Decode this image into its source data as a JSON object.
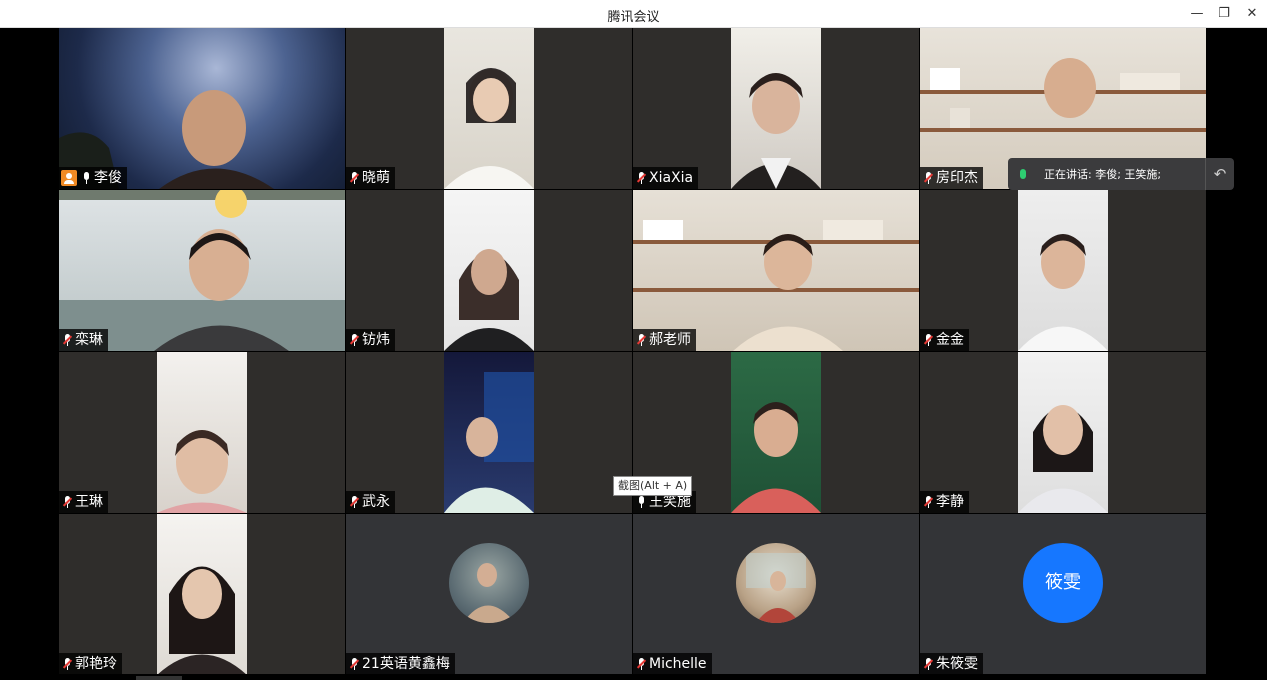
{
  "window": {
    "title": "腾讯会议",
    "minimize": "—",
    "restore": "❐",
    "close": "✕"
  },
  "participants": [
    {
      "name": "李俊",
      "host": true,
      "mic": "on"
    },
    {
      "name": "晓萌",
      "mic": "muted"
    },
    {
      "name": "XiaXia",
      "mic": "muted"
    },
    {
      "name": "房印杰",
      "mic": "muted"
    },
    {
      "name": "栾琳",
      "mic": "muted"
    },
    {
      "name": "钫炜",
      "mic": "muted"
    },
    {
      "name": "郝老师",
      "mic": "muted"
    },
    {
      "name": "金金",
      "mic": "muted"
    },
    {
      "name": "王琳",
      "mic": "muted"
    },
    {
      "name": "武永",
      "mic": "muted"
    },
    {
      "name": "王笑施",
      "mic": "on"
    },
    {
      "name": "李静",
      "mic": "muted"
    },
    {
      "name": "郭艳玲",
      "mic": "muted"
    },
    {
      "name": "21英语黄鑫梅",
      "mic": "muted"
    },
    {
      "name": "Michelle",
      "mic": "muted"
    },
    {
      "name": "朱筱雯",
      "mic": "muted",
      "avatar_text": "筱雯"
    }
  ],
  "speaking_bar": {
    "text": "正在讲话: 李俊; 王笑施;"
  },
  "tooltip": {
    "text": "截图(Alt + A)"
  },
  "colors": {
    "active_border": "#1db954",
    "avatar_blue": "#1677ff",
    "host_orange": "#f08a24",
    "muted_red": "#e53935"
  }
}
